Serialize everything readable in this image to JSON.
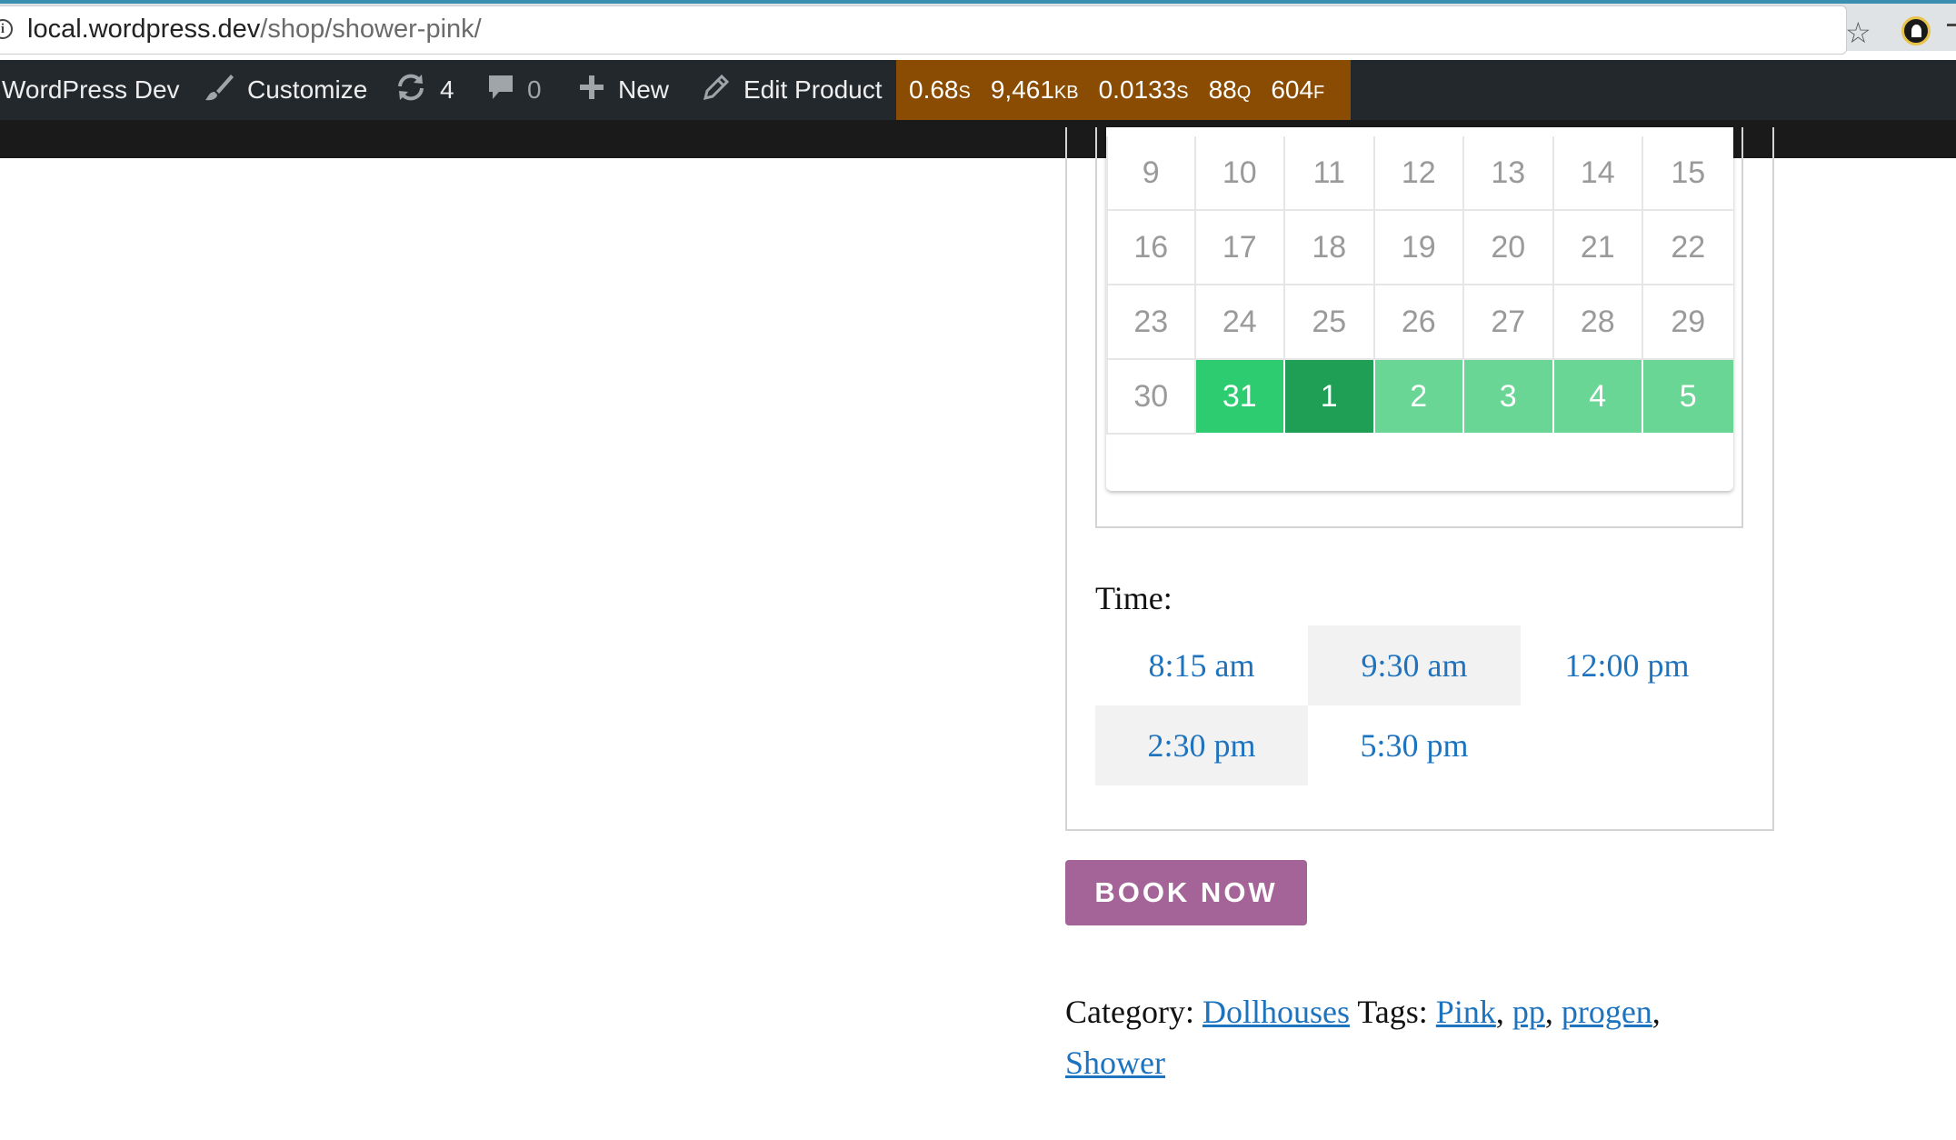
{
  "browser": {
    "url_host": "local.wordpress.dev",
    "url_path": "/shop/shower-pink/"
  },
  "adminbar": {
    "site_name": "WordPress Dev",
    "customize": "Customize",
    "updates_count": "4",
    "comments_count": "0",
    "new_label": "New",
    "edit_label": "Edit Product",
    "query_monitor": {
      "time": "0.68",
      "time_unit": "S",
      "memory": "9,461",
      "memory_unit": "KB",
      "db_time": "0.0133",
      "db_time_unit": "S",
      "queries": "88",
      "queries_unit": "Q",
      "files": "604",
      "files_unit": "F"
    }
  },
  "calendar": {
    "weeks": [
      [
        "9",
        "10",
        "11",
        "12",
        "13",
        "14",
        "15"
      ],
      [
        "16",
        "17",
        "18",
        "19",
        "20",
        "21",
        "22"
      ],
      [
        "23",
        "24",
        "25",
        "26",
        "27",
        "28",
        "29"
      ],
      [
        "30",
        "31",
        "1",
        "2",
        "3",
        "4",
        "5"
      ]
    ]
  },
  "time": {
    "label": "Time:",
    "slots": [
      "8:15 am",
      "9:30 am",
      "12:00 pm",
      "2:30 pm",
      "5:30 pm"
    ]
  },
  "book_button": "BOOK NOW",
  "meta": {
    "category_label": "Category:",
    "category": "Dollhouses",
    "tags_label": "Tags:",
    "tags": [
      "Pink",
      "pp",
      "progen",
      "Shower"
    ]
  },
  "colors": {
    "selected": "#2ecc71",
    "selected_dark": "#1f9e56",
    "selected_light": "#69d695",
    "button": "#a46497",
    "link": "#1e73be",
    "adminbar": "#23282d",
    "query_monitor": "#8a4c02"
  }
}
